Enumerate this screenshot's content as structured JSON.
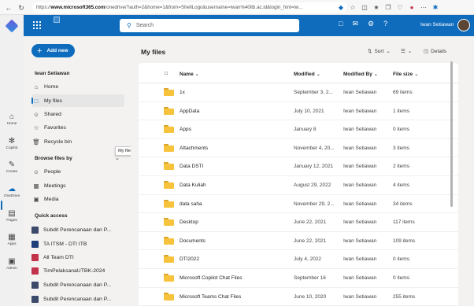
{
  "browser": {
    "url_prefix": "https://",
    "url_host": "www.microsoft365.com",
    "url_path": "/onedrive/?auth=2&home=1&from=ShellLogo&username=iwan%40itb.ac.id&login_hint=iw..."
  },
  "app_rail": {
    "items": [
      {
        "label": "Home"
      },
      {
        "label": "Copilot"
      },
      {
        "label": "Create"
      },
      {
        "label": "OneDrive"
      },
      {
        "label": "Pages"
      },
      {
        "label": "Apps"
      },
      {
        "label": "Admin"
      }
    ]
  },
  "topbar": {
    "search_placeholder": "Search",
    "user_name": "Iwan Setiawan"
  },
  "leftnav": {
    "add_new_label": "Add new",
    "owner": "Iwan Setiawan",
    "items": [
      {
        "label": "Home"
      },
      {
        "label": "My files"
      },
      {
        "label": "Shared"
      },
      {
        "label": "Favorites"
      },
      {
        "label": "Recycle bin"
      }
    ],
    "tooltip": "My files",
    "browse_heading": "Browse files by",
    "browse_items": [
      {
        "label": "People"
      },
      {
        "label": "Meetings"
      },
      {
        "label": "Media"
      }
    ],
    "quick_access_heading": "Quick access",
    "quick_access": [
      {
        "label": "Subdit Perencanaan dan P...",
        "color": "#3b4a6b"
      },
      {
        "label": "TA ITSM - DTI ITB",
        "color": "#1f3f7a"
      },
      {
        "label": "All Team DTI",
        "color": "#c4314b"
      },
      {
        "label": "TimPelaksanaUTBK-2024",
        "color": "#c4314b"
      },
      {
        "label": "Subdit Perencanaan dan P...",
        "color": "#3b4a6b"
      },
      {
        "label": "Subdit Perencanaan dan P...",
        "color": "#3b4a6b"
      }
    ]
  },
  "main": {
    "title": "My files",
    "sort_label": "Sort",
    "details_label": "Details",
    "columns": {
      "name": "Name",
      "modified": "Modified",
      "modified_by": "Modified By",
      "file_size": "File size"
    },
    "rows": [
      {
        "name": "1x",
        "modified": "September 3, 2...",
        "by": "Iwan Setiawan",
        "size": "69 items"
      },
      {
        "name": "AppData",
        "modified": "July 10, 2021",
        "by": "Iwan Setiawan",
        "size": "1 items"
      },
      {
        "name": "Apps",
        "modified": "January 8",
        "by": "Iwan Setiawan",
        "size": "0 items"
      },
      {
        "name": "Attachments",
        "modified": "November 4, 20...",
        "by": "Iwan Setiawan",
        "size": "3 items"
      },
      {
        "name": "Data DSTI",
        "modified": "January 12, 2021",
        "by": "Iwan Setiawan",
        "size": "2 items"
      },
      {
        "name": "Data Kuliah",
        "modified": "August 29, 2022",
        "by": "Iwan Setiawan",
        "size": "4 items"
      },
      {
        "name": "data saha",
        "modified": "November 29, 2...",
        "by": "Iwan Setiawan",
        "size": "34 items"
      },
      {
        "name": "Desktop",
        "modified": "June 22, 2021",
        "by": "Iwan Setiawan",
        "size": "117 items"
      },
      {
        "name": "Documents",
        "modified": "June 22, 2021",
        "by": "Iwan Setiawan",
        "size": "109 items"
      },
      {
        "name": "DTI2022",
        "modified": "July 4, 2022",
        "by": "Iwan Setiawan",
        "size": "0 items"
      },
      {
        "name": "Microsoft Copilot Chat Files",
        "modified": "September 16",
        "by": "Iwan Setiawan",
        "size": "0 items"
      },
      {
        "name": "Microsoft Teams Chat Files",
        "modified": "June 10, 2020",
        "by": "Iwan Setiawan",
        "size": "255 items"
      }
    ]
  }
}
